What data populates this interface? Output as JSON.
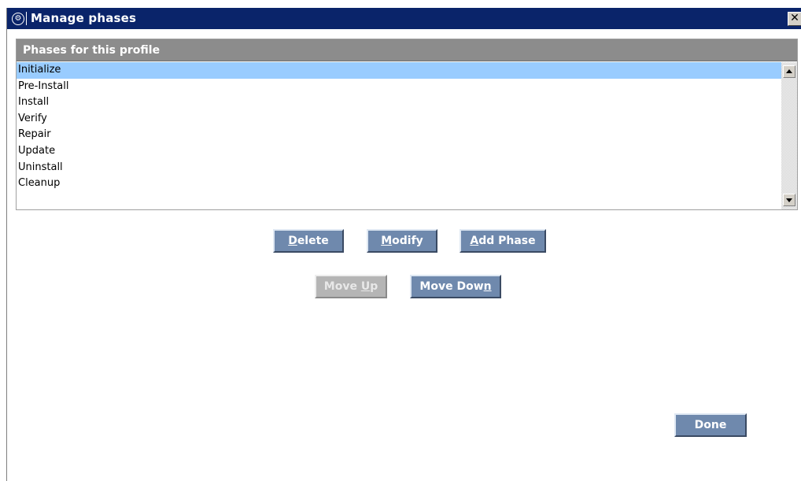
{
  "window": {
    "title": "Manage phases",
    "app_icon": "settings-app-icon",
    "close_glyph": "✕"
  },
  "panel": {
    "header": "Phases for this profile",
    "phases": [
      "Initialize",
      "Pre-Install",
      "Install",
      "Verify",
      "Repair",
      "Update",
      "Uninstall",
      "Cleanup"
    ],
    "selected_index": 0
  },
  "buttons": {
    "delete": {
      "pre": "",
      "key": "D",
      "post": "elete"
    },
    "modify": {
      "pre": "",
      "key": "M",
      "post": "odify"
    },
    "add_phase": {
      "pre": "",
      "key": "A",
      "post": "dd Phase"
    },
    "move_up": {
      "pre": "Move ",
      "key": "U",
      "post": "p"
    },
    "move_down": {
      "pre": "Move Dow",
      "key": "n",
      "post": ""
    },
    "done": {
      "pre": "Done",
      "key": "",
      "post": ""
    }
  },
  "colors": {
    "titlebar": "#0a246a",
    "panel_header": "#8c8c8c",
    "selection": "#99ccff",
    "button": "#6f89ad",
    "button_disabled": "#b5b5b5"
  }
}
